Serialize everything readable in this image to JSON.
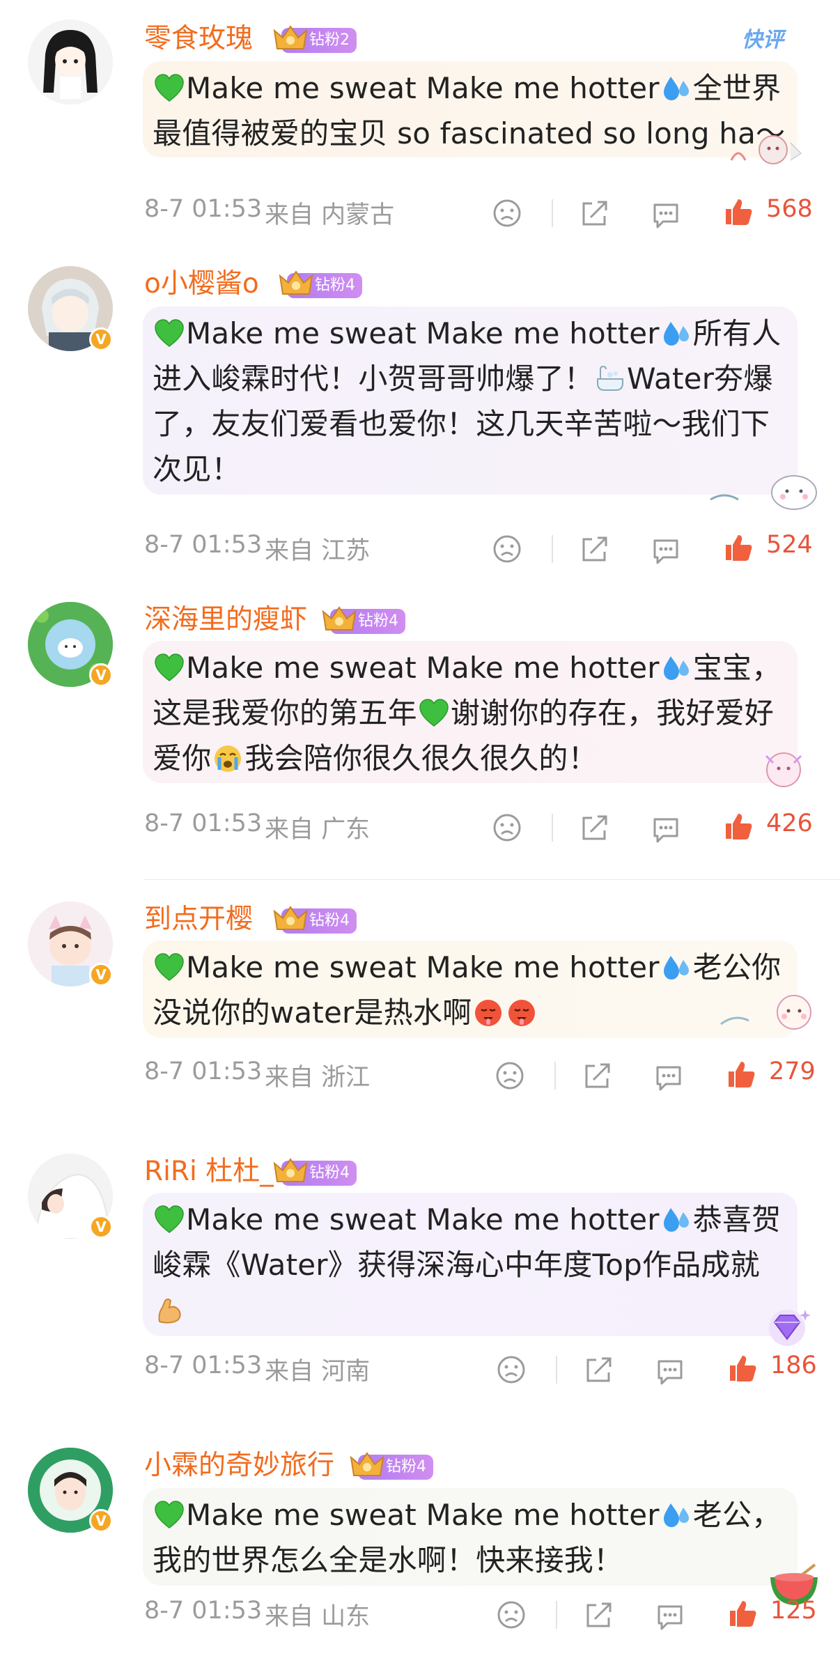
{
  "corner_tag": "快评",
  "colors": {
    "username": "#f26c1e",
    "meta": "#9b9b9b",
    "like": "#e8543a",
    "badge": "#b27cf0"
  },
  "comments": [
    {
      "username": "零食玫瑰",
      "fan_badge": "钻粉2",
      "text_before": "Make me sweat Make me hotter",
      "text_after": "全世界最值得被爱的宝贝 so fascinated so long ha～",
      "time": "8-7 01:53",
      "location": "来自 内蒙古",
      "likes": "568",
      "bubble_color": "#fdf5ea"
    },
    {
      "username": "o小樱酱o",
      "fan_badge": "钻粉4",
      "text_before": "Make me sweat Make me hotter",
      "text_after": "所有人进入峻霖时代！小贺哥哥帅爆了！",
      "text_after2": "Water夯爆了，友友们爱看也爱你！这几天辛苦啦～我们下次见！",
      "time": "8-7 01:53",
      "location": "来自 江苏",
      "likes": "524",
      "bubble_color": "#f4f1fb"
    },
    {
      "username": "深海里的瘦虾",
      "fan_badge": "钻粉4",
      "text_before": "Make me sweat Make me hotter",
      "text_after": "宝宝，这是我爱你的第五年",
      "text_after2": "谢谢你的存在，我好爱好爱你",
      "text_after3": "我会陪你很久很久很久的！",
      "time": "8-7 01:53",
      "location": "来自 广东",
      "likes": "426",
      "bubble_color": "#fbf2f6"
    },
    {
      "username": "到点开樱",
      "fan_badge": "钻粉4",
      "text_before": "Make me sweat Make me hotter",
      "text_after": "老公你没说你的water是热水啊",
      "time": "8-7 01:53",
      "location": "来自 浙江",
      "likes": "279",
      "bubble_color": "#fdf8ee"
    },
    {
      "username": "RiRi 杜杜_",
      "fan_badge": "钻粉4",
      "text_before": "Make me sweat Make me hotter",
      "text_after": "恭喜贺峻霖《Water》获得深海心中年度Top作品成就",
      "time": "8-7 01:53",
      "location": "来自 河南",
      "likes": "186",
      "bubble_color": "#f6f2fc"
    },
    {
      "username": "小霖的奇妙旅行",
      "fan_badge": "钻粉4",
      "text_before": "Make me sweat Make me hotter",
      "text_after": "老公，我的世界怎么全是水啊！快来接我！",
      "time": "8-7 01:53",
      "location": "来自 山东",
      "likes": "125",
      "bubble_color": "#f7f7f4"
    }
  ]
}
